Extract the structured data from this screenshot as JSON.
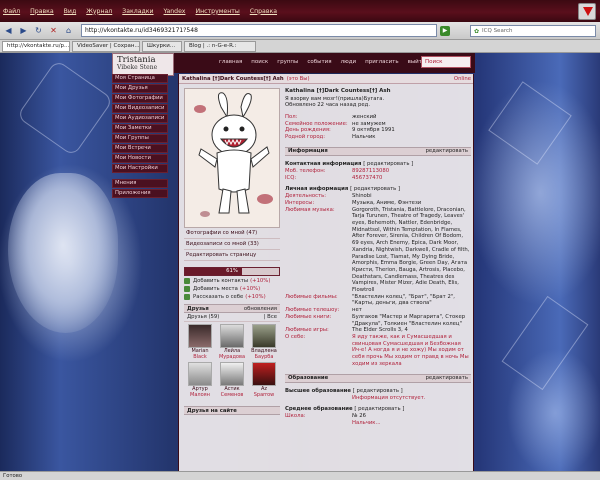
{
  "browser": {
    "menu": [
      "Файл",
      "Правка",
      "Вид",
      "Журнал",
      "Закладки",
      "Yandex",
      "Инструменты",
      "Справка"
    ],
    "url": "http://vkontakte.ru/id346932171?548",
    "search_placeholder": "ICQ Search",
    "tabs": [
      "http://vkontakte.ru/p...",
      "VideoSaver | Сохран...",
      "Шкурки...",
      "Blog | .: n-G-e-R.:"
    ],
    "status": "Готово"
  },
  "site": {
    "logo_title": "Tristania",
    "logo_sub": "Vibeke Stene",
    "nav": [
      "главная",
      "поиск",
      "группы",
      "события",
      "люди",
      "пригласить",
      "выйти"
    ],
    "search_placeholder": "Поиск"
  },
  "left_menu": [
    "Моя Страница",
    "Мои Друзья",
    "Мои Фотографии",
    "Мои Видеозаписи",
    "Мои Аудиозаписи",
    "Мои Заметки",
    "Мои Группы",
    "Мои Встречи",
    "Мои Новости",
    "Мои Настройки"
  ],
  "left_menu_extra": [
    "Мнения",
    "Приложения"
  ],
  "profile": {
    "title": "Kathalina [†]Dark Countess[†] Ash",
    "online_inline": "(это Вы)",
    "online": "Online",
    "name": "Kathalina [†]Dark Countess[†] Ash",
    "status": "Я взорву вам мозг!(пришла)Бугага.",
    "updated": "Обновлено 22 часа назад ред.",
    "basic": [
      {
        "label": "Пол:",
        "value": "женский"
      },
      {
        "label": "Семейное положение:",
        "value": "не замужем"
      },
      {
        "label": "День рождения:",
        "value": "9 октября 1991"
      },
      {
        "label": "Родной город:",
        "value": "Нальчик"
      }
    ],
    "sections": {
      "info": "Информация",
      "edit": "редактировать",
      "contact": "Контактная информация",
      "contact_edit": "[ редактировать ]",
      "personal": "Личная информация",
      "personal_edit": "[ редактировать ]",
      "education": "Образование",
      "higher": "Высшее образование",
      "higher_edit": "[ редактировать ]",
      "higher_note": "Информация отсутствует.",
      "secondary": "Среднее образование",
      "secondary_edit": "[ редактировать ]"
    },
    "contacts": [
      {
        "label": "Моб. телефон:",
        "value": "89287113080"
      },
      {
        "label": "ICQ:",
        "value": "456737470"
      }
    ],
    "personal": [
      {
        "label": "Деятельность:",
        "value": "Shinobi",
        "red": false
      },
      {
        "label": "Интересы:",
        "value": "Музыка, Аниме, Фэнтези",
        "red": false
      },
      {
        "label": "Любимая музыка:",
        "value": "Gorgoroth, Tristania, Battlelore, Draconian, Tarja Turunen, Theatre of Tragedy, Leaves' eyes, Behemoth, Nattler, Edenbridge, Midnattsol, Within Temptation, In Flames, After Forever, Sirenia, Children Of Bodom, 69 eyes, Arch Enemy, Epica, Dark Moor, Xandria, Nightwish, Darkwell, Cradle of filth, Paradise Lost, Tiamat, My Dying Bride, Amorphis, Emma Borgie, Green Day, Агата Кристи, Therion, Bauga, Artrosis, Placebo, Deathstars, Candlemass, Theatres des Vampires, Mister Mizer, Adie Death, Elis, Flowtroll",
        "red": false
      },
      {
        "label": "Любимые фильмы:",
        "value": "\"Властелин колец\", \"Брат\", \"Брат 2\", \"Карты, деньги, два ствола\"",
        "red": false
      },
      {
        "label": "Любимые телешоу:",
        "value": "нет",
        "red": false
      },
      {
        "label": "Любимые книги:",
        "value": "Булгаков \"Мастер и Маргарита\", Стокер \"Дракула\", Толкиен \"Властелин колец\"",
        "red": false
      },
      {
        "label": "Любимые игры:",
        "value": "The Elder Scrolls 3, 4",
        "red": false
      },
      {
        "label": "О себе:",
        "value": "Я иду также, как и Сумасшедшая и свинцовая Сумасшедшая и Безбожная Ич-е! А ногда я и не хожу) Мы ходим от себя прочь Мы ходим от правд в ночь Мы ходим из зеркала",
        "red": true
      }
    ],
    "secondary_school": {
      "label": "Школа:",
      "value": "№ 26"
    },
    "secondary_city": "Нальчик..."
  },
  "left_column": {
    "links": [
      "Фотографии со мной (47)",
      "Видеозаписи со мной (33)",
      "Редактировать страницу"
    ],
    "rating": 61,
    "rating_label": "61%",
    "adds": [
      {
        "label": "Добавить контакты",
        "extra": "(+10%)"
      },
      {
        "label": "Добавить места",
        "extra": "(+10%)"
      },
      {
        "label": "Рассказать о себе",
        "extra": "(+10%)"
      }
    ],
    "friends_head": "Друзья",
    "friends_updates": "обновления",
    "friends_count": "Друзья (59)",
    "friends_all": "| Все",
    "friends": [
      {
        "name": "Marian",
        "surname": "Black"
      },
      {
        "name": "Лейла",
        "surname": "Мурадова"
      },
      {
        "name": "Владлена",
        "surname": "Баурба"
      },
      {
        "name": "Артур",
        "surname": "Малоян"
      },
      {
        "name": "Астик",
        "surname": "Семенов"
      },
      {
        "name": "Az",
        "surname": "Sparrow"
      }
    ],
    "friends_online": "Друзья на сайте"
  }
}
